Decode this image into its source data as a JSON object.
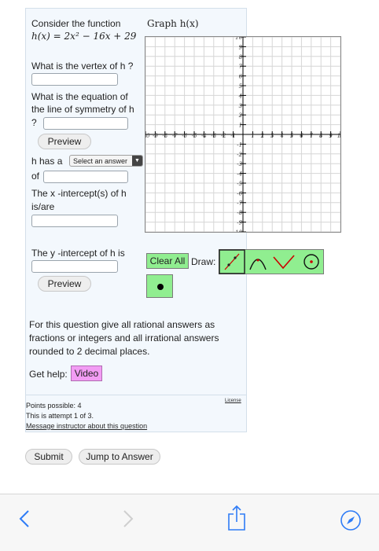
{
  "question": {
    "intro": "Consider the function",
    "function": "h(x) = 2x² − 16x + 29",
    "q_vertex": "What is the vertex of h ?",
    "q_symmetry_1": "What is the equation of",
    "q_symmetry_2": "the line of symmetry of h",
    "q_symmetry_3": "?",
    "preview_label": "Preview",
    "has_a_prefix": "h has a",
    "select_placeholder": "Select an answer",
    "of_label": "of",
    "q_xint_1": "The x -intercept(s) of h",
    "q_xint_2": "is/are",
    "q_yint": "The y -intercept of h  is",
    "preview2_label": "Preview",
    "instructions": "For this question give all rational answers as fractions or integers and all irrational answers rounded to 2 decimal places.",
    "help_label": "Get help:",
    "video_label": "Video"
  },
  "graph": {
    "title": "Graph h(x)",
    "x_ticks": [
      "-10",
      "-9",
      "-8",
      "-7",
      "-6",
      "-5",
      "-4",
      "-3",
      "-2",
      "-1",
      "1",
      "2",
      "3",
      "4",
      "5",
      "6",
      "7",
      "8",
      "9",
      "10"
    ],
    "y_ticks": [
      "10",
      "9",
      "8",
      "7",
      "6",
      "5",
      "4",
      "3",
      "2",
      "1",
      "-1",
      "-2",
      "-3",
      "-4",
      "-5",
      "-6",
      "-7",
      "-8",
      "-9",
      "-10"
    ],
    "range": [
      -10,
      10
    ]
  },
  "tools": {
    "clear_all": "Clear All",
    "draw_label": "Draw:",
    "items": [
      "line-tool",
      "parabola-tool",
      "vee-tool",
      "circle-tool",
      "point-tool"
    ]
  },
  "footer": {
    "points": "Points possible: 4",
    "attempt": "This is attempt 1 of 3.",
    "message_link": "Message instructor about this question",
    "license": "License"
  },
  "actions": {
    "submit": "Submit",
    "jump": "Jump to Answer"
  },
  "colors": {
    "tool_bg": "#90ee90",
    "video_bg": "#f29cf4",
    "panel_bg": "#f3f8fd",
    "ios_blue": "#2f7cf6"
  }
}
